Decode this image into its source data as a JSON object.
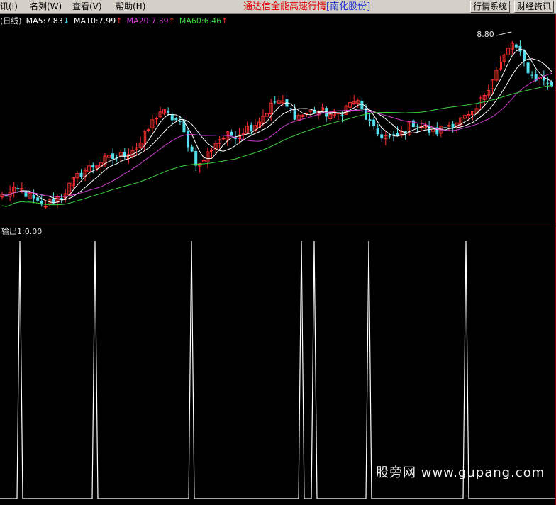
{
  "menu": {
    "items": [
      {
        "label": "讯(I)"
      },
      {
        "label": "名列(W)"
      },
      {
        "label": "查看(V)"
      },
      {
        "label": "帮助(H)"
      }
    ]
  },
  "title": {
    "main": "通达信全能高速行情",
    "bracket": "[南化股份]"
  },
  "toolbar": {
    "quotes_label": "行情系统",
    "finance_label": "财经资讯"
  },
  "legend": {
    "period": "(日线)",
    "items": [
      {
        "label": "MA5:7.83",
        "arrow": "↓",
        "color": "#ffffff",
        "arrow_color": "#4ad3ee"
      },
      {
        "label": "MA10:7.99",
        "arrow": "↑",
        "color": "#ffffff",
        "arrow_color": "#ff3030"
      },
      {
        "label": "MA20:7.39",
        "arrow": "↑",
        "color": "#d23fd2",
        "arrow_color": "#ff3030"
      },
      {
        "label": "MA60:6.46",
        "arrow": "↑",
        "color": "#3dd33d",
        "arrow_color": "#ff3030"
      }
    ]
  },
  "annotations": {
    "high_price": "8.80"
  },
  "indicator": {
    "label": "输出1:0.00"
  },
  "watermark": "股旁网 www.gupang.com",
  "colors": {
    "background": "#000000",
    "grid": "#8b0000",
    "up_candle": "#ff3030",
    "down_candle": "#55e0f0",
    "ma5": "#ffffff",
    "ma10": "#ffffff",
    "ma20": "#d23fd2",
    "ma60": "#3dd33d",
    "signal": "#ffffff"
  },
  "chart_data": {
    "type": "candlestick",
    "price_series": [
      {
        "name": "MA5",
        "last": 7.83
      },
      {
        "name": "MA10",
        "last": 7.99
      },
      {
        "name": "MA20",
        "last": 7.39
      },
      {
        "name": "MA60",
        "last": 6.46
      }
    ],
    "annotated_high": 8.8,
    "price_path": [
      5.9,
      6.0,
      5.7,
      5.9,
      6.3,
      6.5,
      6.6,
      6.8,
      7.4,
      7.2,
      6.4,
      6.9,
      7.0,
      7.2,
      7.6,
      7.3,
      7.4,
      7.3,
      7.6,
      7.0,
      6.9,
      7.2,
      7.0,
      7.2,
      7.3,
      8.0,
      8.6,
      8.0,
      7.9
    ],
    "signal_series": {
      "name": "输出1",
      "last": 0.0,
      "min": 0,
      "max": 1
    }
  }
}
